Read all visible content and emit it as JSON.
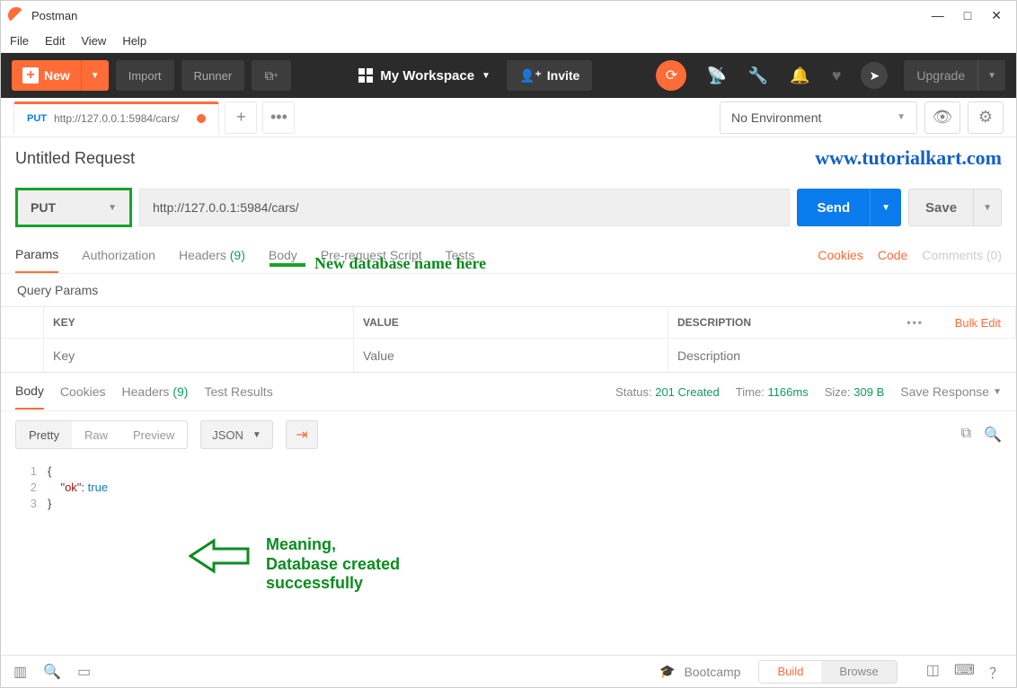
{
  "app_title": "Postman",
  "menubar": [
    "File",
    "Edit",
    "View",
    "Help"
  ],
  "toolbar": {
    "new_label": "New",
    "import_label": "Import",
    "runner_label": "Runner",
    "workspace_label": "My Workspace",
    "invite_label": "Invite",
    "upgrade_label": "Upgrade"
  },
  "tab": {
    "method": "PUT",
    "label": "http://127.0.0.1:5984/cars/"
  },
  "environment": {
    "selected": "No Environment"
  },
  "request": {
    "title": "Untitled Request",
    "method": "PUT",
    "url": "http://127.0.0.1:5984/cars/",
    "send_label": "Send",
    "save_label": "Save"
  },
  "watermark": "www.tutorialkart.com",
  "annotation_url": "New database name here",
  "req_tabs": {
    "params": "Params",
    "auth": "Authorization",
    "headers": "Headers",
    "headers_count": "(9)",
    "body": "Body",
    "prereq": "Pre-request Script",
    "tests": "Tests"
  },
  "tabs_right": {
    "cookies": "Cookies",
    "code": "Code",
    "comments": "Comments (0)"
  },
  "qp": {
    "label": "Query Params",
    "key_hdr": "KEY",
    "val_hdr": "VALUE",
    "desc_hdr": "DESCRIPTION",
    "bulk": "Bulk Edit",
    "key_ph": "Key",
    "val_ph": "Value",
    "desc_ph": "Description"
  },
  "resp_tabs": {
    "body": "Body",
    "cookies": "Cookies",
    "headers": "Headers",
    "headers_count": "(9)",
    "tests": "Test Results"
  },
  "status": {
    "status_label": "Status:",
    "status_value": "201 Created",
    "time_label": "Time:",
    "time_value": "1166ms",
    "size_label": "Size:",
    "size_value": "309 B",
    "save_response": "Save Response"
  },
  "view": {
    "pretty": "Pretty",
    "raw": "Raw",
    "preview": "Preview",
    "lang": "JSON"
  },
  "response_body": {
    "line1": "{",
    "line2_key": "\"ok\"",
    "line2_colon": ": ",
    "line2_val": "true",
    "line3": "}",
    "ln1": "1",
    "ln2": "2",
    "ln3": "3"
  },
  "annotation_resp": {
    "l1": "Meaning,",
    "l2": "Database created",
    "l3": "successfully"
  },
  "footer": {
    "bootcamp": "Bootcamp",
    "build": "Build",
    "browse": "Browse"
  }
}
